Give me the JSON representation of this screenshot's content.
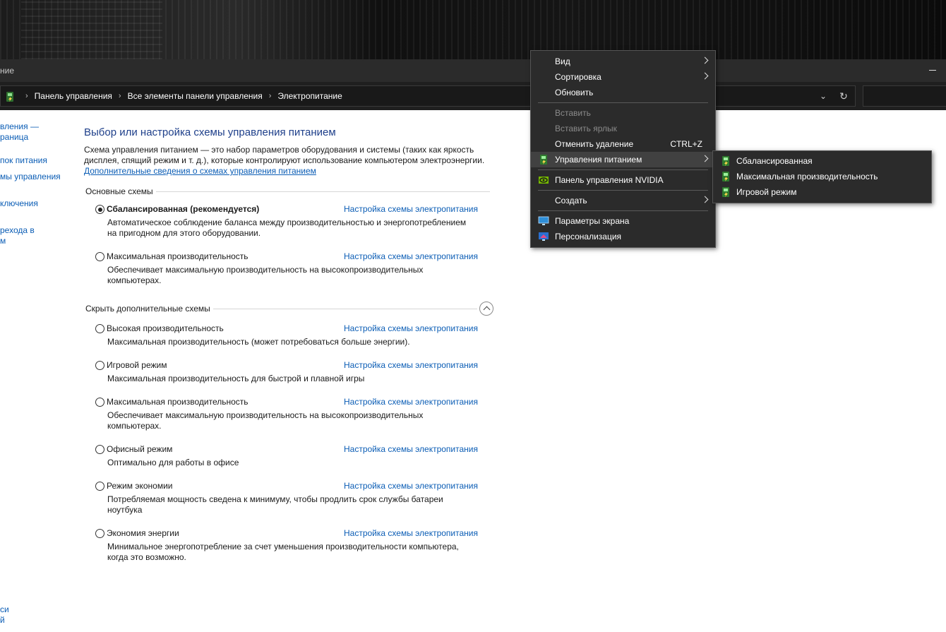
{
  "window": {
    "title_partial": "ние"
  },
  "address": {
    "crumbs": [
      "Панель управления",
      "Все элементы панели управления",
      "Электропитание"
    ],
    "sep": "›",
    "dropdown_glyph": "⌄",
    "refresh_glyph": "↻"
  },
  "leftnav": {
    "items": [
      "вления —",
      "раница",
      "пок питания",
      "мы управления",
      "ключения",
      "рехода в",
      "м",
      "си",
      "й"
    ]
  },
  "main": {
    "title": "Выбор или настройка схемы управления питанием",
    "description": "Схема управления питанием — это набор параметров оборудования и системы (таких как яркость дисплея, спящий режим и т. д.), которые контролируют использование компьютером электроэнергии.",
    "more_link": "Дополнительные сведения о схемах управления питанием",
    "group_main": "Основные схемы",
    "group_extra": "Скрыть дополнительные схемы",
    "settings_link": "Настройка схемы электропитания",
    "plans_main": [
      {
        "name": "Сбалансированная (рекомендуется)",
        "selected": true,
        "desc": "Автоматическое соблюдение баланса между производительностью и энергопотреблением на пригодном для этого оборудовании."
      },
      {
        "name": "Максимальная производительность",
        "selected": false,
        "desc": "Обеспечивает максимальную производительность на высокопроизводительных компьютерах."
      }
    ],
    "plans_extra": [
      {
        "name": "Высокая производительность",
        "selected": false,
        "desc": "Максимальная производительность (может потребоваться больше энергии)."
      },
      {
        "name": "Игровой режим",
        "selected": false,
        "desc": "Максимальная производительность для быстрой и плавной игры"
      },
      {
        "name": "Максимальная производительность",
        "selected": false,
        "desc": "Обеспечивает максимальную производительность на высокопроизводительных компьютерах."
      },
      {
        "name": "Офисный режим",
        "selected": false,
        "desc": "Оптимально для работы в офисе"
      },
      {
        "name": "Режим экономии",
        "selected": false,
        "desc": "Потребляемая мощность сведена к минимуму, чтобы продлить срок службы батареи ноутбука"
      },
      {
        "name": "Экономия энергии",
        "selected": false,
        "desc": "Минимальное энергопотребление за счет уменьшения производительности компьютера, когда это возможно."
      }
    ]
  },
  "context_menu": {
    "view": "Вид",
    "sort": "Сортировка",
    "refresh": "Обновить",
    "paste": "Вставить",
    "paste_shortcut": "Вставить ярлык",
    "undo": "Отменить удаление",
    "undo_shortcut": "CTRL+Z",
    "power": "Управления питанием",
    "nvidia": "Панель управления NVIDIA",
    "create": "Создать",
    "display": "Параметры экрана",
    "personalize": "Персонализация"
  },
  "submenu": {
    "items": [
      "Сбалансированная",
      "Максимальная производительность",
      "Игровой режим"
    ]
  },
  "colors": {
    "link": "#0b5db5",
    "title": "#1e3f8a",
    "menu_bg": "#2b2b2b",
    "menu_highlight": "#414141",
    "power_icon": "#3fbf3f",
    "nvidia": "#76b900"
  }
}
